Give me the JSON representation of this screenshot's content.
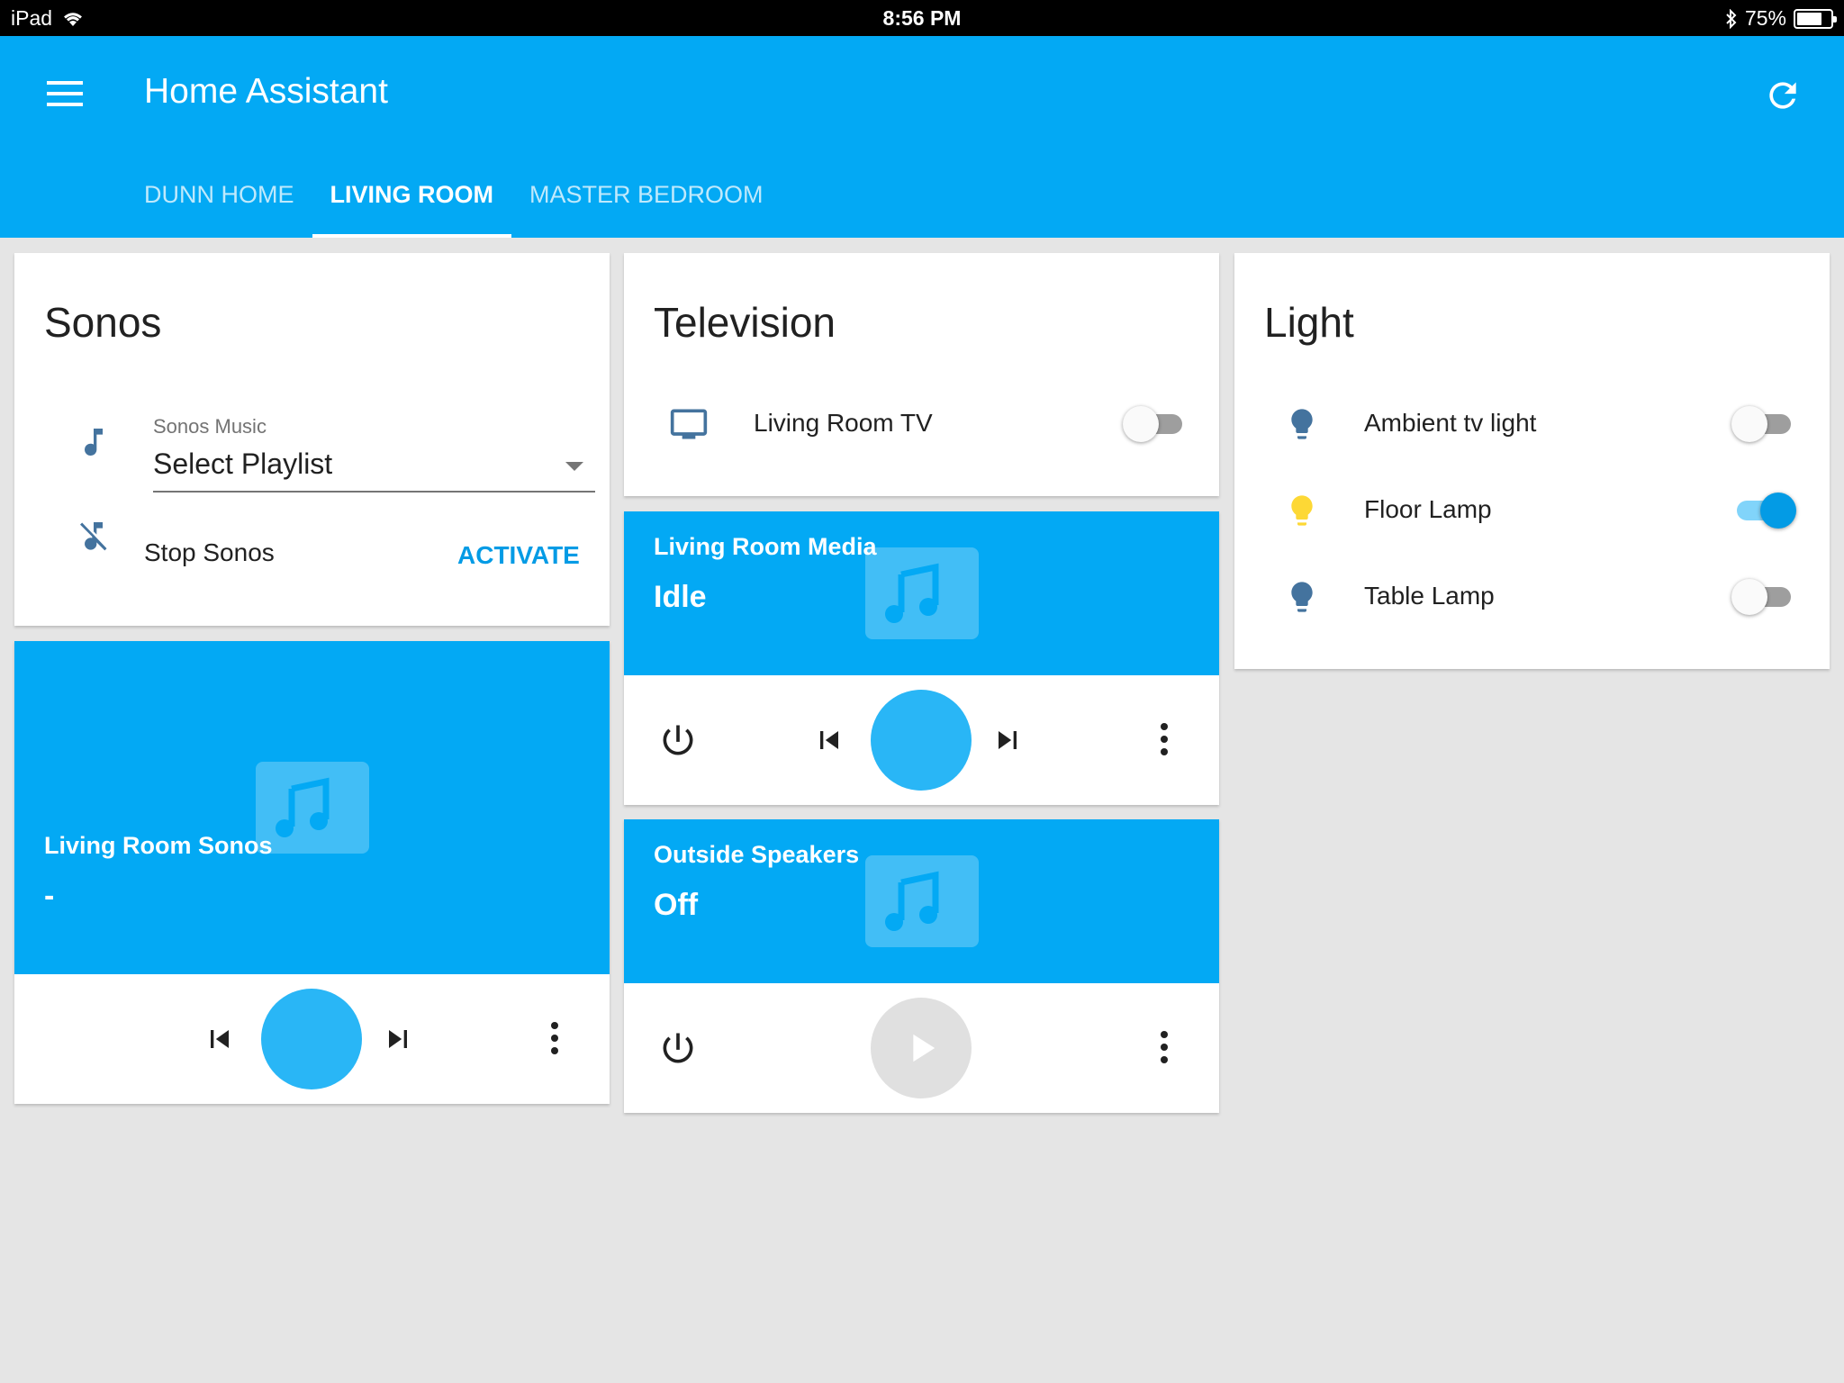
{
  "status_bar": {
    "device": "iPad",
    "time": "8:56 PM",
    "battery": "75%",
    "battery_level": 0.75
  },
  "header": {
    "title": "Home Assistant"
  },
  "tabs": [
    {
      "label": "DUNN HOME",
      "active": false
    },
    {
      "label": "LIVING ROOM",
      "active": true
    },
    {
      "label": "MASTER BEDROOM",
      "active": false
    }
  ],
  "sonos_card": {
    "title": "Sonos",
    "select": {
      "label": "Sonos Music",
      "value": "Select Playlist"
    },
    "script": {
      "label": "Stop Sonos",
      "action": "ACTIVATE"
    }
  },
  "living_room_sonos": {
    "name": "Living Room Sonos",
    "state": "-"
  },
  "television_card": {
    "title": "Television",
    "items": [
      {
        "label": "Living Room TV",
        "on": false
      }
    ]
  },
  "living_room_media": {
    "name": "Living Room Media",
    "state": "Idle"
  },
  "outside_speakers": {
    "name": "Outside Speakers",
    "state": "Off"
  },
  "light_card": {
    "title": "Light",
    "items": [
      {
        "label": "Ambient tv light",
        "on": false
      },
      {
        "label": "Floor Lamp",
        "on": true
      },
      {
        "label": "Table Lamp",
        "on": false
      }
    ]
  },
  "colors": {
    "primary": "#03a9f4",
    "accent": "#039be5",
    "icon_off": "#44739e",
    "icon_on": "#fdd835",
    "background": "#e5e5e5"
  },
  "icons": {
    "menu": "menu-icon",
    "refresh": "refresh-icon",
    "music_note": "music-note-icon",
    "music_off": "music-off-icon",
    "tv": "television-icon",
    "bulb": "lightbulb-icon",
    "power": "power-icon",
    "prev": "skip-previous-icon",
    "next": "skip-next-icon",
    "more": "more-vert-icon",
    "play": "play-icon",
    "art": "movie-music-icon"
  }
}
